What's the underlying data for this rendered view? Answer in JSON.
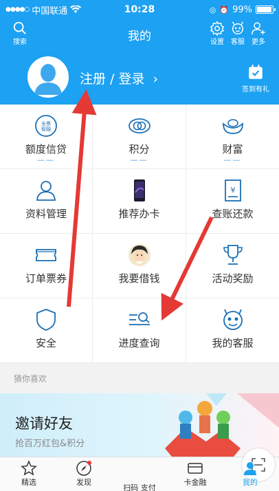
{
  "status_bar": {
    "carrier": "中国联通",
    "time": "10:28",
    "battery": "99%"
  },
  "header": {
    "title": "我的",
    "search_label": "搜索",
    "settings_label": "设置",
    "service_label": "客服",
    "more_label": "更多"
  },
  "profile": {
    "login_text": "注册 / 登录",
    "chevron": "›",
    "signin_label": "签到有礼"
  },
  "grid": [
    {
      "label": "额度信贷",
      "sub": "——",
      "icon": "panorama-credit-icon"
    },
    {
      "label": "积分",
      "sub": "——",
      "icon": "points-icon"
    },
    {
      "label": "财富",
      "sub": "——",
      "icon": "wealth-icon"
    },
    {
      "label": "资料管理",
      "icon": "profile-icon"
    },
    {
      "label": "推荐办卡",
      "icon": "phone-icon"
    },
    {
      "label": "查账还款",
      "icon": "bill-icon"
    },
    {
      "label": "订单票券",
      "icon": "ticket-icon"
    },
    {
      "label": "我要借钱",
      "icon": "borrow-avatar-icon"
    },
    {
      "label": "活动奖励",
      "icon": "trophy-icon"
    },
    {
      "label": "安全",
      "icon": "shield-icon"
    },
    {
      "label": "进度查询",
      "icon": "progress-search-icon"
    },
    {
      "label": "我的客服",
      "icon": "robot-icon"
    }
  ],
  "section": {
    "guess_title": "猜你喜欢"
  },
  "banner": {
    "title": "邀请好友",
    "subtitle": "抢百万红包&积分"
  },
  "tabbar": {
    "items": [
      {
        "label": "精选",
        "icon": "star-icon"
      },
      {
        "label": "发现",
        "icon": "compass-icon"
      },
      {
        "label": "扫码 支付",
        "icon": "scan-icon"
      },
      {
        "label": "卡金融",
        "icon": "card-icon"
      },
      {
        "label": "我的",
        "icon": "user-icon"
      }
    ]
  },
  "colors": {
    "primary": "#1da1f2",
    "arrow": "#e53935"
  }
}
